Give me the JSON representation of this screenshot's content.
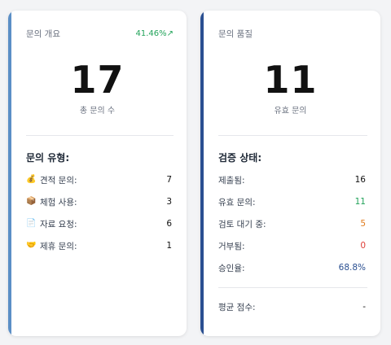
{
  "overview": {
    "title": "문의 개요",
    "trend": "41.46%↗",
    "total": "17",
    "total_label": "총 문의 수",
    "section_title": "문의 유형:",
    "types": [
      {
        "icon": "money-bag-icon",
        "glyph": "💰",
        "label": "견적 문의:",
        "value": "7"
      },
      {
        "icon": "package-icon",
        "glyph": "📦",
        "label": "체험 사용:",
        "value": "3"
      },
      {
        "icon": "document-icon",
        "glyph": "📄",
        "label": "자료 요청:",
        "value": "6"
      },
      {
        "icon": "handshake-icon",
        "glyph": "🤝",
        "label": "제휴 문의:",
        "value": "1"
      }
    ]
  },
  "quality": {
    "title": "문의 품질",
    "valid": "11",
    "valid_label": "유효 문의",
    "section_title": "검증 상태:",
    "stats": [
      {
        "label": "제출됨:",
        "value": "16",
        "color": "#111111"
      },
      {
        "label": "유효 문의:",
        "value": "11",
        "color": "#22a35a"
      },
      {
        "label": "검토 대기 중:",
        "value": "5",
        "color": "#e07b1c"
      },
      {
        "label": "거부됨:",
        "value": "0",
        "color": "#e0413a"
      },
      {
        "label": "승인율:",
        "value": "68.8%",
        "color": "#2a4f91"
      }
    ],
    "avg_label": "평균 점수:",
    "avg_value": "-"
  },
  "colors": {
    "left_accent": "#5b8fc6",
    "right_accent": "#2a4f91",
    "trend_up": "#22a35a"
  }
}
